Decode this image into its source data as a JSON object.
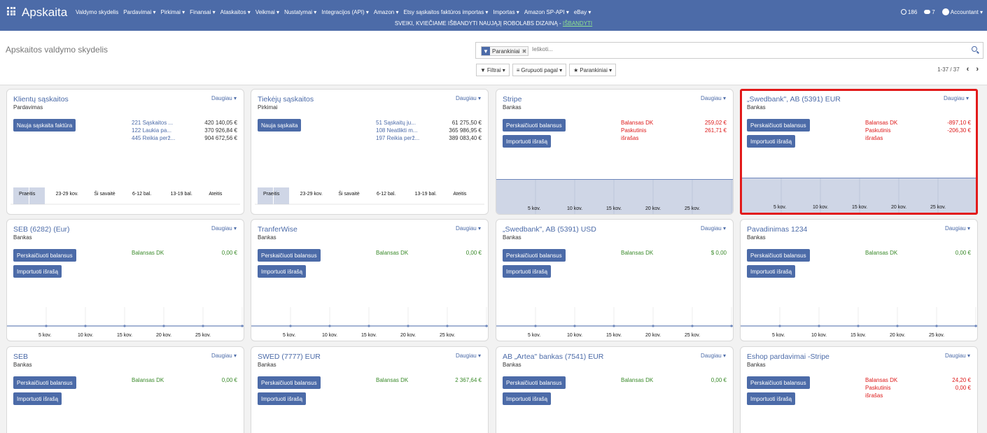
{
  "app": {
    "title": "Apskaita"
  },
  "menu": [
    "Valdymo skydelis",
    "Pardavimai ▾",
    "Pirkimai ▾",
    "Finansai ▾",
    "Ataskaitos ▾",
    "Veikmai ▾",
    "Nustatymai ▾",
    "Integracijos (API) ▾",
    "Amazon ▾",
    "Etsy sąskaitos faktūros importas ▾",
    "Importas ▾",
    "Amazon SP-API ▾",
    "eBay ▾"
  ],
  "topright": {
    "activity_count": "186",
    "messages_count": "7",
    "user": "Accountant ▾"
  },
  "announcement": {
    "text": "SVEIKI, KVIEČIAME IŠBANDYTI NAUJĄJĮ ROBOLABS DIZAINĄ -",
    "link": "IŠBANDYTI"
  },
  "page": {
    "title": "Apskaitos valdymo skydelis"
  },
  "search": {
    "facet_label": "Parankiniai",
    "placeholder": "Ieškoti..."
  },
  "toolbar": {
    "filters": "Filtrai ▾",
    "groupby": "Grupuoti pagal ▾",
    "favorites": "Parankiniai ▾"
  },
  "pager": {
    "text": "1-37 / 37"
  },
  "colors": {
    "nav": "#4c6ba8",
    "selected_border": "#e21a1a",
    "chart_fill": "#cfd6e6",
    "balance_green": "#3a8a2a",
    "balance_red": "#dd1a1a"
  },
  "cards": [
    {
      "title": "Klientų sąskaitos",
      "subtitle": "Pardavimas",
      "more": "Daugiau",
      "btn1": "Nauja sąskaita faktūra",
      "lines": [
        {
          "label": "221 Sąskaitos ...",
          "value": "420 140,05 €"
        },
        {
          "label": "122 Laukia pa...",
          "value": "370 926,84 €"
        },
        {
          "label": "445 Reikia perž...",
          "value": "904 672,56 €"
        }
      ],
      "chart": {
        "type": "bar",
        "categories": [
          "Praeitis",
          "23-29 kov.",
          "Ši savaitė",
          "6-12 bal.",
          "13-19 bal.",
          "Ateitis"
        ],
        "values": [
          1,
          0,
          0,
          0,
          0,
          0
        ]
      }
    },
    {
      "title": "Tiekėjų sąskaitos",
      "subtitle": "Pirkimai",
      "more": "Daugiau",
      "btn1": "Nauja sąskaita",
      "lines": [
        {
          "label": "51 Sąskaitų ju...",
          "value": "61 275,50 €"
        },
        {
          "label": "108 Neatlikti m...",
          "value": "365 986,95 €"
        },
        {
          "label": "197 Reikia perž...",
          "value": "389 083,40 €"
        }
      ],
      "chart": {
        "type": "bar",
        "categories": [
          "Praeitis",
          "23-29 kov.",
          "Ši savaitė",
          "6-12 bal.",
          "13-19 bal.",
          "Ateitis"
        ],
        "values": [
          1,
          0,
          0,
          0,
          0,
          0
        ]
      }
    },
    {
      "title": "Stripe",
      "subtitle": "Bankas",
      "more": "Daugiau",
      "btn1": "Perskaičiuoti balansus",
      "btn2": "Importuoti išrašą",
      "balance_color": "red",
      "lines": [
        {
          "label": "Balansas DK",
          "value": "259,02 €"
        },
        {
          "label": "Paskutinis",
          "value": "261,71 €"
        },
        {
          "label": "išrašas",
          "value": ""
        }
      ],
      "chart": {
        "type": "area",
        "x": [
          "5 kov.",
          "10 kov.",
          "15 kov.",
          "20 kov.",
          "25 kov."
        ],
        "filled": true
      }
    },
    {
      "title": "„Swedbank\", AB (5391) EUR",
      "subtitle": "Bankas",
      "more": "Daugiau",
      "btn1": "Perskaičiuoti balansus",
      "btn2": "Importuoti išrašą",
      "balance_color": "red",
      "selected": true,
      "lines": [
        {
          "label": "Balansas DK",
          "value": "-897,10 €"
        },
        {
          "label": "Paskutinis",
          "value": "-206,30 €"
        },
        {
          "label": "išrašas",
          "value": ""
        }
      ],
      "chart": {
        "type": "area",
        "x": [
          "5 kov.",
          "10 kov.",
          "15 kov.",
          "20 kov.",
          "25 kov."
        ],
        "filled": true
      }
    },
    {
      "title": "SEB (6282) (Eur)",
      "subtitle": "Bankas",
      "more": "Daugiau",
      "btn1": "Perskaičiuoti balansus",
      "btn2": "Importuoti išrašą",
      "balance_color": "green",
      "lines": [
        {
          "label": "Balansas DK",
          "value": "0,00 €"
        }
      ],
      "chart": {
        "type": "line",
        "x": [
          "5 kov.",
          "10 kov.",
          "15 kov.",
          "20 kov.",
          "25 kov."
        ],
        "filled": false
      }
    },
    {
      "title": "TranferWise",
      "subtitle": "Bankas",
      "more": "Daugiau",
      "btn1": "Perskaičiuoti balansus",
      "btn2": "Importuoti išrašą",
      "balance_color": "green",
      "lines": [
        {
          "label": "Balansas DK",
          "value": "0,00 €"
        }
      ],
      "chart": {
        "type": "line",
        "x": [
          "5 kov.",
          "10 kov.",
          "15 kov.",
          "20 kov.",
          "25 kov."
        ],
        "filled": false
      }
    },
    {
      "title": "„Swedbank\", AB (5391) USD",
      "subtitle": "Bankas",
      "more": "Daugiau",
      "btn1": "Perskaičiuoti balansus",
      "btn2": "Importuoti išrašą",
      "balance_color": "green",
      "lines": [
        {
          "label": "Balansas DK",
          "value": "$ 0,00"
        }
      ],
      "chart": {
        "type": "line",
        "x": [
          "5 kov.",
          "10 kov.",
          "15 kov.",
          "20 kov.",
          "25 kov."
        ],
        "filled": false
      }
    },
    {
      "title": "Pavadinimas 1234",
      "subtitle": "Bankas",
      "more": "Daugiau",
      "btn1": "Perskaičiuoti balansus",
      "btn2": "Importuoti išrašą",
      "balance_color": "green",
      "lines": [
        {
          "label": "Balansas DK",
          "value": "0,00 €"
        }
      ],
      "chart": {
        "type": "line",
        "x": [
          "5 kov.",
          "10 kov.",
          "15 kov.",
          "20 kov.",
          "25 kov."
        ],
        "filled": false
      }
    },
    {
      "title": "SEB",
      "subtitle": "Bankas",
      "more": "Daugiau",
      "btn1": "Perskaičiuoti balansus",
      "btn2": "Importuoti išrašą",
      "balance_color": "green",
      "lines": [
        {
          "label": "Balansas DK",
          "value": "0,00 €"
        }
      ]
    },
    {
      "title": "SWED (7777) EUR",
      "subtitle": "Bankas",
      "more": "Daugiau",
      "btn1": "Perskaičiuoti balansus",
      "btn2": "Importuoti išrašą",
      "balance_color": "green",
      "lines": [
        {
          "label": "Balansas DK",
          "value": "2 367,64 €"
        }
      ]
    },
    {
      "title": "AB „Artea\" bankas (7541) EUR",
      "subtitle": "Bankas",
      "more": "Daugiau",
      "btn1": "Perskaičiuoti balansus",
      "btn2": "Importuoti išrašą",
      "balance_color": "green",
      "lines": [
        {
          "label": "Balansas DK",
          "value": "0,00 €"
        }
      ]
    },
    {
      "title": "Eshop pardavimai -Stripe",
      "subtitle": "Bankas",
      "more": "Daugiau",
      "btn1": "Perskaičiuoti balansus",
      "btn2": "Importuoti išrašą",
      "balance_color": "red",
      "lines": [
        {
          "label": "Balansas DK",
          "value": "24,20 €"
        },
        {
          "label": "Paskutinis",
          "value": "0,00 €"
        },
        {
          "label": "išrašas",
          "value": ""
        }
      ]
    }
  ]
}
